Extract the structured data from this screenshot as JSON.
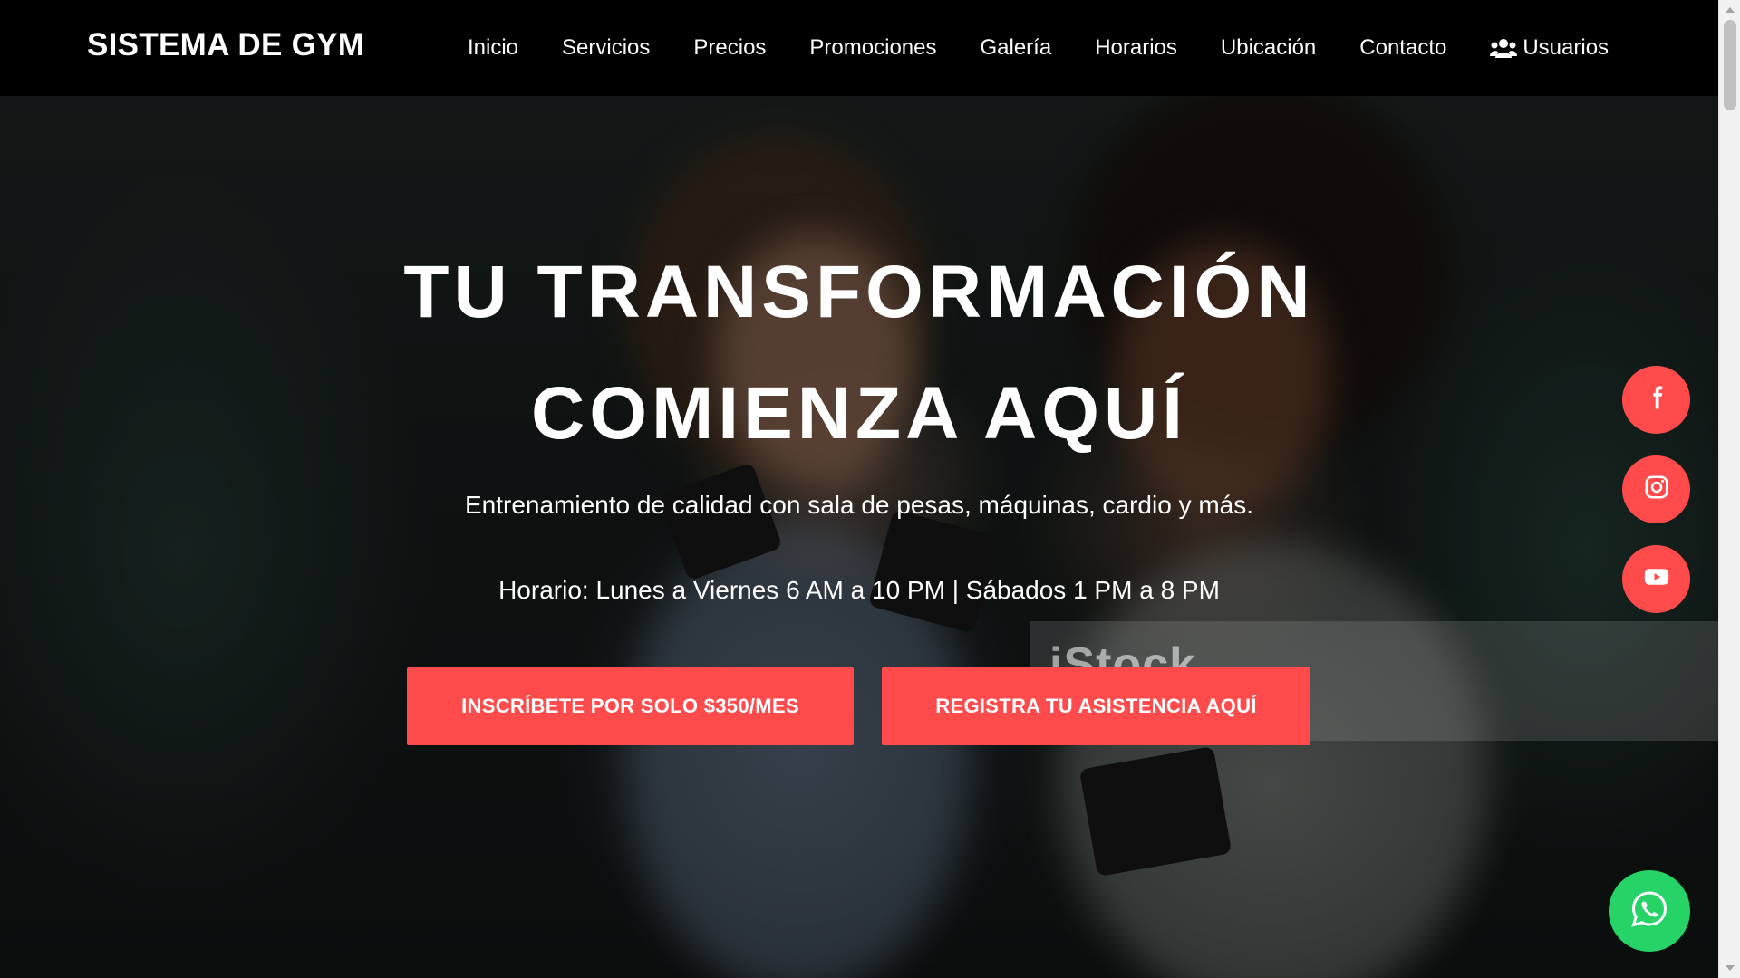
{
  "nav": {
    "brand": "SISTEMA DE GYM",
    "links": [
      "Inicio",
      "Servicios",
      "Precios",
      "Promociones",
      "Galería",
      "Horarios",
      "Ubicación",
      "Contacto"
    ],
    "users_label": "Usuarios",
    "users_icon": "users-icon"
  },
  "hero": {
    "title_line1": "TU TRANSFORMACIÓN",
    "title_line2": "COMIENZA AQUÍ",
    "subtitle": "Entrenamiento de calidad con sala de pesas, máquinas, cardio y más.",
    "schedule": "Horario: Lunes a Viernes 6 AM a 10 PM | Sábados 1 PM a 8 PM",
    "signup_button": "INSCRÍBETE POR SOLO $350/MES",
    "attendance_button": "REGISTRA TU ASISTENCIA AQUÍ",
    "watermark": "iStock"
  },
  "social": {
    "icons": [
      "facebook-icon",
      "instagram-icon",
      "youtube-icon"
    ],
    "whatsapp_icon": "whatsapp-icon"
  },
  "colors": {
    "navbar": "#000000",
    "accent": "#ff4b4b",
    "whatsapp": "#25d366",
    "text": "#ffffff"
  }
}
